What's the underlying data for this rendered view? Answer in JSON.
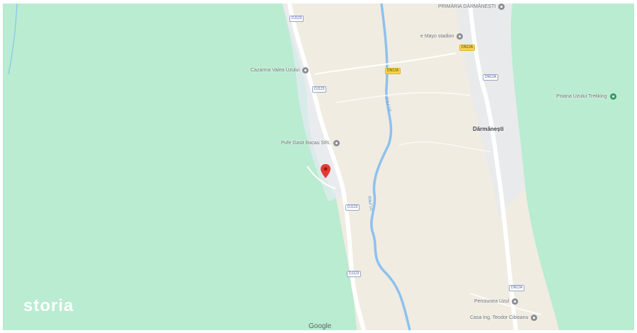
{
  "map": {
    "colors": {
      "forest": "#b9ecd1",
      "valley": "#f0ece2",
      "road": "#ffffff",
      "river": "#8ec1ee",
      "marker": "#e53935"
    },
    "town": "Dărmănești",
    "pois": [
      {
        "label": "PRIMĂRIA DĂRMĂNEȘTI",
        "icon": "landmark-icon"
      },
      {
        "label": "e Mayo stadion",
        "icon": "place-icon"
      },
      {
        "label": "Cazarma Valea Uzului",
        "icon": "place-icon"
      },
      {
        "label": "Poiana Uzului Trekking",
        "icon": "park-icon"
      },
      {
        "label": "Pufe Gasit Bacau SRL",
        "icon": "business-icon"
      },
      {
        "label": "Pensiunea Uzul",
        "icon": "place-icon"
      },
      {
        "label": "Casa Ing. Teodor Cibisanu",
        "icon": "place-icon"
      }
    ],
    "road_shields": [
      "DJ123",
      "DJ123",
      "DJ123",
      "DJ123",
      "DN12A",
      "DN12A",
      "DN12A",
      "DN12A"
    ],
    "river_labels": [
      "Râul Uz",
      "Râul Uz"
    ],
    "marker_icon": "location-pin-icon"
  },
  "branding": {
    "watermark": "storia",
    "attribution": "Google"
  }
}
